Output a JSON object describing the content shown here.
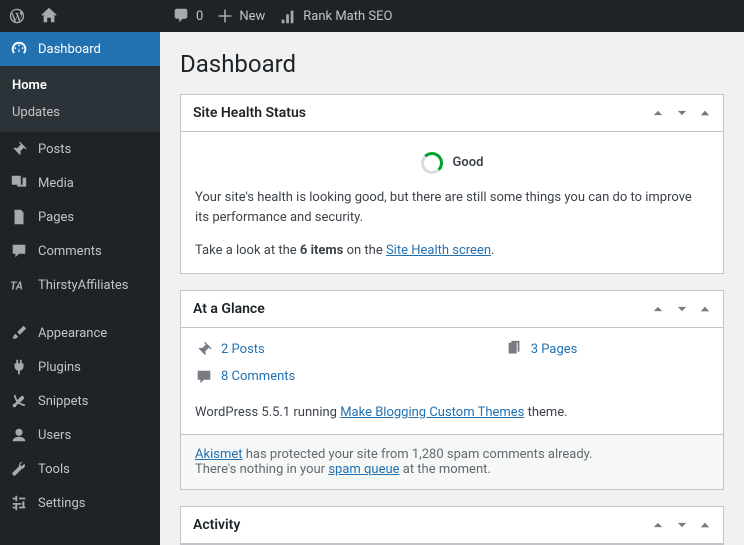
{
  "topbar": {
    "comments_count": "0",
    "new_label": "New",
    "rankmath": "Rank Math SEO"
  },
  "sidebar": {
    "dashboard": "Dashboard",
    "home": "Home",
    "updates": "Updates",
    "posts": "Posts",
    "media": "Media",
    "pages": "Pages",
    "comments": "Comments",
    "thirsty": "ThirstyAffiliates",
    "appearance": "Appearance",
    "plugins": "Plugins",
    "snippets": "Snippets",
    "users": "Users",
    "tools": "Tools",
    "settings": "Settings"
  },
  "page": {
    "title": "Dashboard"
  },
  "health": {
    "title": "Site Health Status",
    "status": "Good",
    "desc": "Your site's health is looking good, but there are still some things you can do to improve its performance and security.",
    "take_prefix": "Take a look at the ",
    "items_bold": "6 items",
    "take_mid": " on the ",
    "screen_link": "Site Health screen",
    "period": "."
  },
  "glance": {
    "title": "At a Glance",
    "posts": "2 Posts",
    "pages": "3 Pages",
    "comments": "8 Comments",
    "wp_prefix": "WordPress 5.5.1 running ",
    "theme_link": "Make Blogging Custom Themes",
    "wp_suffix": " theme.",
    "akismet_link": "Akismet",
    "akismet_text": " has protected your site from 1,280 spam comments already.",
    "akismet_line2_a": "There's nothing in your ",
    "akismet_queue": "spam queue",
    "akismet_line2_b": " at the moment."
  },
  "activity": {
    "title": "Activity"
  }
}
